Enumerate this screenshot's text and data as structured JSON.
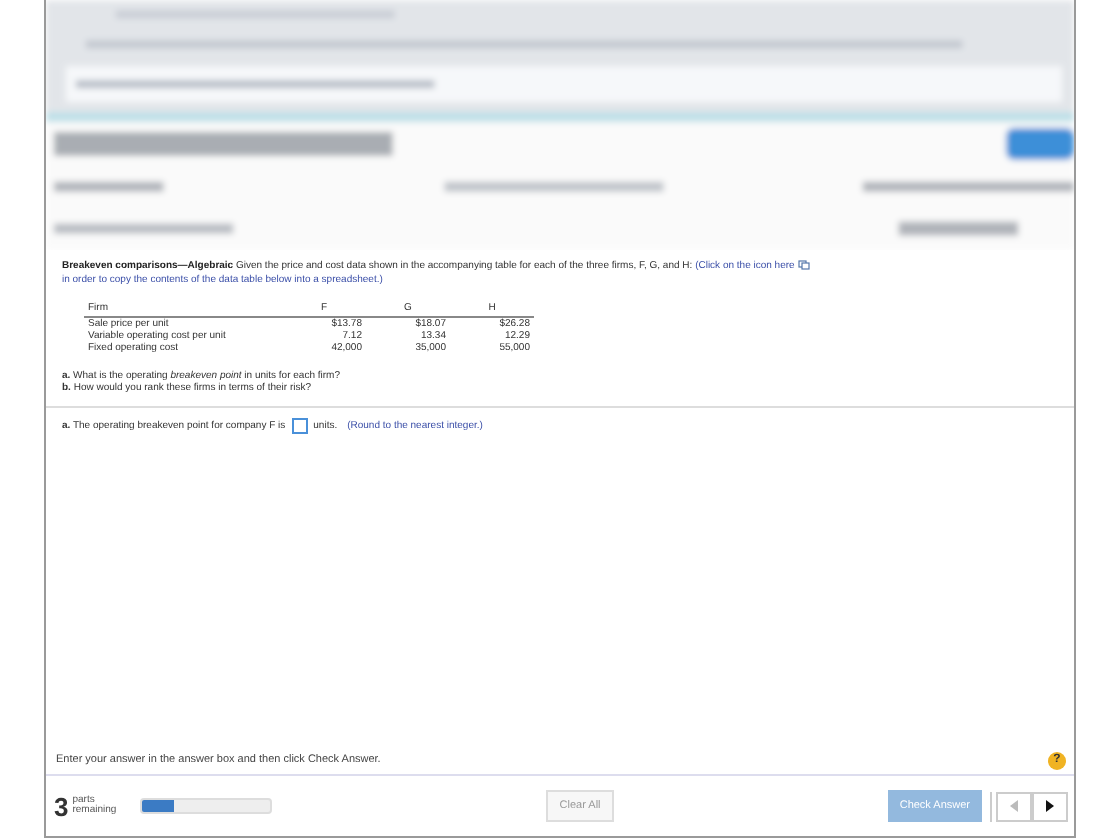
{
  "question": {
    "title": "Breakeven comparisons—Algebraic",
    "intro": "Given the price and cost data shown in the accompanying table for each of the three firms, F, G, and H:",
    "link_before": "(Click on the icon here",
    "link_after": "in order to copy the contents of the data table below into a spreadsheet.)",
    "table": {
      "columns": [
        "Firm",
        "F",
        "G",
        "H"
      ],
      "rows": [
        [
          "Sale price per unit",
          "$13.78",
          "$18.07",
          "$26.28"
        ],
        [
          "Variable operating cost per unit",
          "7.12",
          "13.34",
          "12.29"
        ],
        [
          "Fixed operating cost",
          "42,000",
          "35,000",
          "55,000"
        ]
      ]
    },
    "parts": [
      "**a.** What is the operating *breakeven point* in units for each firm?",
      "**b.** How would you rank these firms in terms of their risk?"
    ]
  },
  "answer": {
    "before": "**a.**  The operating breakeven point for company F is",
    "after": "units.",
    "hint": "(Round to the nearest integer.)"
  },
  "instruction": "Enter your answer in the answer box and then click Check Answer.",
  "help": "?",
  "footer": {
    "count": "3",
    "count_label": "parts remaining",
    "level": 0.25,
    "clear": "Clear All",
    "check": "Check Answer",
    "check_disabled": true,
    "prev_disabled": true,
    "next_disabled": false
  }
}
